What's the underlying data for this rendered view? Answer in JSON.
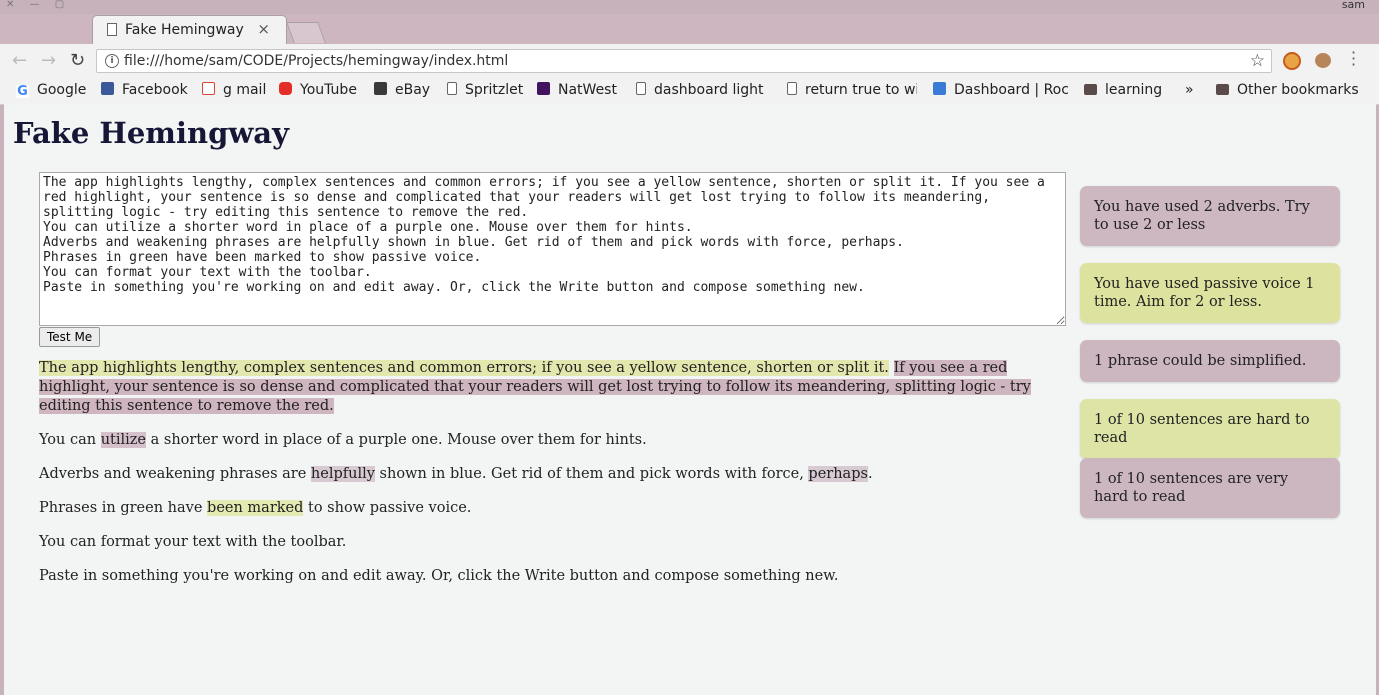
{
  "browser": {
    "os_user": "sam",
    "tab": {
      "title": "Fake Hemingway",
      "close_glyph": "×"
    },
    "url": "file:///home/sam/CODE/Projects/hemingway/index.html",
    "bookmarks": [
      {
        "label": "Google",
        "icon": "google-icon",
        "color": "#4285f4"
      },
      {
        "label": "Facebook",
        "icon": "facebook-icon",
        "color": "#3b5998"
      },
      {
        "label": "g mail",
        "icon": "gmail-icon",
        "color": "#d44638"
      },
      {
        "label": "YouTube",
        "icon": "youtube-icon",
        "color": "#e52d27"
      },
      {
        "label": "eBay",
        "icon": "ebay-icon",
        "color": "#3a3a3a"
      },
      {
        "label": "Spritzlet",
        "icon": "page-icon",
        "color": "#ffffff"
      },
      {
        "label": "NatWest",
        "icon": "natwest-icon",
        "color": "#42145f"
      },
      {
        "label": "dashboard light",
        "icon": "page-icon",
        "color": "#ffffff"
      },
      {
        "label": "return true to wi",
        "icon": "page-icon",
        "color": "#ffffff"
      },
      {
        "label": "Dashboard | Roc",
        "icon": "dashboard-icon",
        "color": "#3a7bd5"
      },
      {
        "label": "learning",
        "icon": "folder-icon",
        "color": "#5a4a4a"
      }
    ],
    "overflow": "»",
    "other_bookmarks": "Other bookmarks"
  },
  "app": {
    "title": "Fake Hemingway",
    "textarea_value": "The app highlights lengthy, complex sentences and common errors; if you see a yellow sentence, shorten or split it. If you see a red highlight, your sentence is so dense and complicated that your readers will get lost trying to follow its meandering, splitting logic - try editing this sentence to remove the red.\nYou can utilize a shorter word in place of a purple one. Mouse over them for hints.\nAdverbs and weakening phrases are helpfully shown in blue. Get rid of them and pick words with force, perhaps.\nPhrases in green have been marked to show passive voice.\nYou can format your text with the toolbar.\nPaste in something you're working on and edit away. Or, click the Write button and compose something new.",
    "test_button": "Test Me",
    "output": {
      "p1": {
        "yellow": "The app highlights lengthy, complex sentences and common errors; if you see a yellow sentence, shorten or split it.",
        "red": "If you see a red highlight, your sentence is so dense and complicated that your readers will get lost trying to follow its meandering, splitting logic - try editing this sentence to remove the red."
      },
      "p2": {
        "a": "You can ",
        "purple": "utilize",
        "b": " a shorter word in place of a purple one. Mouse over them for hints."
      },
      "p3": {
        "a": "Adverbs and weakening phrases are ",
        "blue1": "helpfully",
        "b": " shown in blue. Get rid of them and pick words with force, ",
        "blue2": "perhaps",
        "c": "."
      },
      "p4": {
        "a": "Phrases in green have ",
        "green": "been marked",
        "b": " to show passive voice."
      },
      "p5": "You can format your text with the toolbar.",
      "p6": "Paste in something you're working on and edit away. Or, click the Write button and compose something new."
    },
    "stats": {
      "adverbs": "You have used 2 adverbs. Try to use 2 or less",
      "passive": "You have used passive voice 1 time. Aim for 2 or less.",
      "complex": "1 phrase could be simplified.",
      "hard": "1 of 10 sentences are hard to read",
      "very_hard": "1 of 10 sentences are very hard to read"
    }
  }
}
